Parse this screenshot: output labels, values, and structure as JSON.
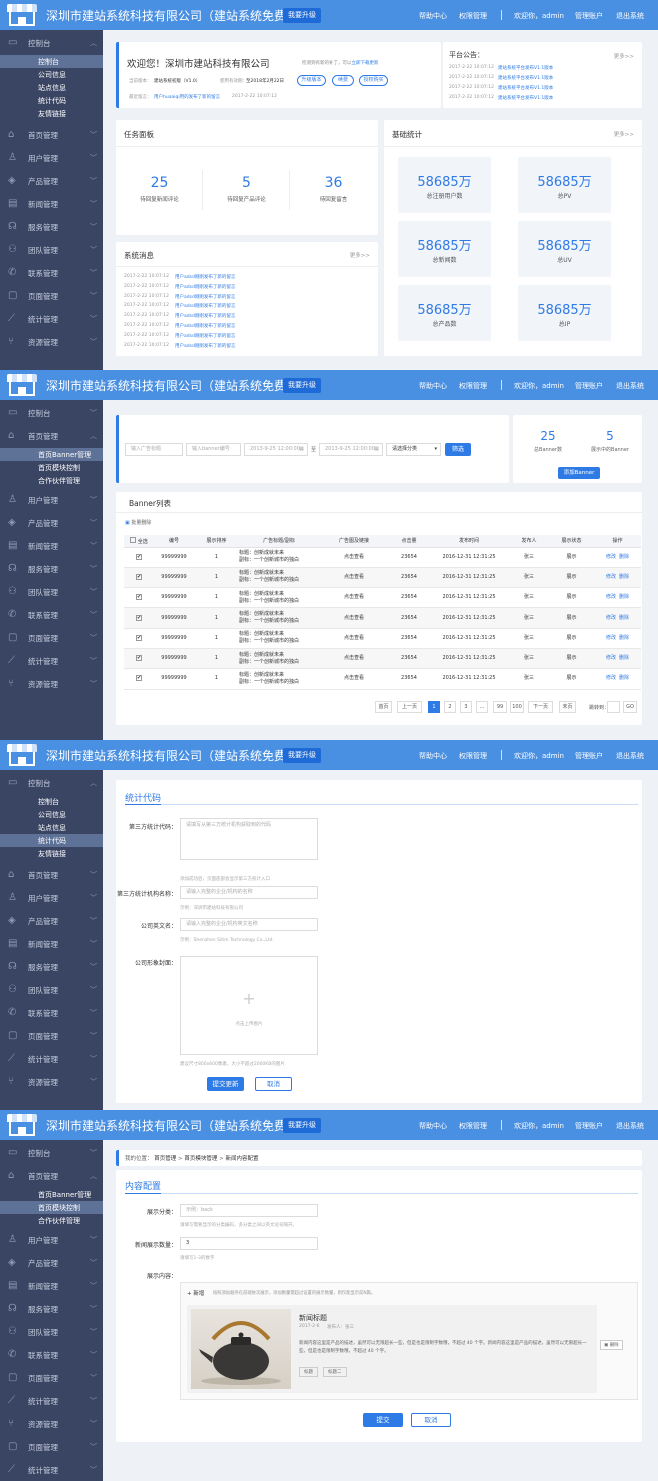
{
  "header": {
    "site_title": "深圳市建站系统科技有限公司（建站系统免费版）",
    "upgrade_label": "我要升级",
    "nav": [
      "帮助中心",
      "权限管理",
      "欢迎你，admin",
      "管理账户",
      "退出系统"
    ]
  },
  "sidebar": {
    "dashboard": "控制台",
    "dashboard_subs": [
      "控制台",
      "公司信息",
      "站点信息",
      "统计代码",
      "友情链接"
    ],
    "home": "首页管理",
    "home_subs": [
      "首页Banner管理",
      "首页模块控制",
      "合作伙伴管理"
    ],
    "items": [
      "用户管理",
      "产品管理",
      "新闻管理",
      "服务管理",
      "团队管理",
      "联系管理",
      "页面管理",
      "统计管理",
      "资源管理"
    ]
  },
  "welcome": {
    "title": "欢迎您！深圳市建站科技有限公司",
    "note": "检测到有新的补丁，可以",
    "note_link": "立即下载更新",
    "version_label": "当前版本：",
    "version_value": "建站系统初版（V1.0）",
    "expire_label": "使用有效期：",
    "expire_value": "至2018年2月22日",
    "btn_upgrade": "升级版本",
    "btn_renew": "续费",
    "btn_buy": "授权购买",
    "latest_label": "最近留言：",
    "latest_value": "用户huaaiqi用的发布了新的留言",
    "latest_time": "2017-2-22 10:07:12"
  },
  "notice": {
    "title": "平台公告：",
    "more": "更多>>",
    "items": [
      {
        "time": "2017-2-22 10:07:12",
        "text": "建站系统平台发布V1.1版本"
      },
      {
        "time": "2017-2-22 10:07:12",
        "text": "建站系统平台发布V1.1版本"
      },
      {
        "time": "2017-2-22 10:07:12",
        "text": "建站系统平台发布V1.1版本"
      },
      {
        "time": "2017-2-22 10:07:12",
        "text": "建站系统平台发布V1.1版本"
      }
    ]
  },
  "tasks": {
    "title": "任务面板",
    "items": [
      {
        "value": "25",
        "label": "待回复新闻评论"
      },
      {
        "value": "5",
        "label": "待回复产品评论"
      },
      {
        "value": "36",
        "label": "待回复留言"
      }
    ]
  },
  "stats": {
    "title": "基础统计",
    "more": "更多>>",
    "items": [
      {
        "value": "58685万",
        "label": "总注册用户数"
      },
      {
        "value": "58685万",
        "label": "总PV"
      },
      {
        "value": "58685万",
        "label": "总新闻数"
      },
      {
        "value": "58685万",
        "label": "总UV"
      },
      {
        "value": "58685万",
        "label": "总产品数"
      },
      {
        "value": "58685万",
        "label": "总IP"
      }
    ]
  },
  "sysmsg": {
    "title": "系统消息",
    "more": "更多>>",
    "items": [
      {
        "time": "2017-2-22 10:07:12",
        "text": "用户adsd刚刚发布了新的留言"
      },
      {
        "time": "2017-2-22 10:07:12",
        "text": "用户adsd刚刚发布了新的留言"
      },
      {
        "time": "2017-2-22 10:07:12",
        "text": "用户adsd刚刚发布了新的留言"
      },
      {
        "time": "2017-2-22 10:07:12",
        "text": "用户adsd刚刚发布了新的留言"
      },
      {
        "time": "2017-2-22 10:07:12",
        "text": "用户adsd刚刚发布了新的留言"
      },
      {
        "time": "2017-2-22 10:07:12",
        "text": "用户adsd刚刚发布了新的留言"
      },
      {
        "time": "2017-2-22 10:07:12",
        "text": "用户adsd刚刚发布了新的留言"
      },
      {
        "time": "2017-2-22 10:07:12",
        "text": "用户adsd刚刚发布了新的留言"
      }
    ]
  },
  "banner": {
    "filter": {
      "ph_title": "输入广告标题",
      "ph_id": "输入banner编号",
      "date_start": "2013-9-25 12:00:00",
      "to": "至",
      "date_end": "2013-9-25 12:00:00",
      "select": "请选择分类",
      "btn": "筛选"
    },
    "summary": {
      "total_value": "25",
      "total_label": "总Banner数",
      "showing_value": "5",
      "showing_label": "展示中的Banner",
      "add_btn": "添加Banner"
    },
    "list_title": "Banner列表",
    "batch_delete": "批量删除",
    "columns": [
      "全选",
      "编号",
      "展示排序",
      "广告标题/副标",
      "广告图及链接",
      "点击量",
      "发布时间",
      "发布人",
      "展示状态",
      "操作"
    ],
    "row": {
      "id": "99999999",
      "order": "1",
      "title": "标题：创新成就未来",
      "subtitle": "副标：一个创新城市的独白",
      "link": "点击查看",
      "clicks": "23654",
      "date": "2016-12-31  12:31:25",
      "author": "张三",
      "status": "展示",
      "edit": "修改",
      "delete": "删除"
    },
    "pagination": {
      "first": "首页",
      "prev": "上一页",
      "pages": [
        "1",
        "2",
        "3",
        "...",
        "99",
        "100"
      ],
      "next": "下一页",
      "last": "末页",
      "jump": "跳转到：",
      "go": "GO"
    }
  },
  "stat_code": {
    "title": "统计代码",
    "code_label": "第三方统计代码：",
    "code_ph": "请填写从第三方统计机构获取到的代码",
    "code_hint": "添加成功后，页面底部会显示第三方统计入口",
    "name_label": "第三方统计机构名称：",
    "name_ph": "请输入完整的企业/机构的名称",
    "name_hint": "示例：深圳市建站科技有限公司",
    "en_label": "公司英文名：",
    "en_ph": "请输入完整的企业/机构英文名称",
    "en_hint": "示例：Shenzhen Sitim Technology Co.,Ltd.",
    "img_label": "公司形象封面：",
    "img_plus": "+",
    "img_text": "点击上传图片",
    "img_hint": "建议尺寸800x600像素，大小不超过2000KB的图片",
    "submit": "提交更新",
    "cancel": "取消"
  },
  "content_cfg": {
    "breadcrumb": [
      "我的位置：",
      "首页管理",
      ">",
      "首页模块管理",
      ">",
      "新闻内容配置"
    ],
    "title": "内容配置",
    "cat_label": "展示分类：",
    "cat_ph": "示例：back",
    "cat_hint": "请填写需要显示的分类编码，多分类之间以英文逗号隔开。",
    "num_label": "新闻展示数量：",
    "num_value": "3",
    "num_hint": "请填写1-3的数字",
    "content_label": "展示内容：",
    "add": "+ 新增",
    "add_hint": "按照添加顺序在前端依次展示，添加数量需超过设置的展示数量，则仅能显示前N篇。",
    "news_title": "新闻标题",
    "news_date": "2017-2-6",
    "news_author": "发布人：张三",
    "news_desc": "新闻内容这里是产品的描述，虽然可以无限超长一些，但是也是限制字数哦，不超过 40 个字。新闻内容这里是产品的描述，虽然可以无限超长一些，但是也是限制字数哦，不超过 40 个字。",
    "tag1": "标题",
    "tag2": "标题二",
    "delete": "删除",
    "submit": "提交",
    "cancel": "取消"
  }
}
